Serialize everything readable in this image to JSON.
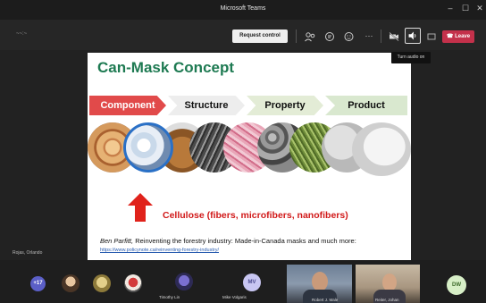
{
  "window": {
    "title": "Microsoft Teams",
    "minimize": "–",
    "maximize": "☐",
    "close": "✕"
  },
  "toolbar": {
    "timer": "~~:~",
    "request_control_label": "Request control",
    "more_label": "···",
    "leave_label": "Leave",
    "audio_tooltip": "Turn audio on"
  },
  "stage": {
    "presenter_name": "Rojas, Orlando"
  },
  "slide": {
    "title": "Can-Mask Concept",
    "steps": [
      "Component",
      "Structure",
      "Property",
      "Product"
    ],
    "cellulose_label": "Cellulose (fibers, microfibers, nanofibers)",
    "citation_author": "Ben Parfitt,",
    "citation_text": " Reinventing the forestry industry: Made-in-Canada masks and much more:",
    "citation_url": "https://www.policynote.ca/reinventing-forestry-industry/"
  },
  "participants": {
    "overflow_count": "+17",
    "tiles": [
      {
        "name": "Timothy Lin"
      },
      {
        "name": "Mike Volgaris",
        "initials": "MV"
      },
      {
        "name": "Robert J. Male"
      },
      {
        "name": "Reiter, Johan"
      }
    ],
    "dw_initials": "DW"
  },
  "colors": {
    "leave": "#c4314b",
    "accent_red": "#e14a4a",
    "title_green": "#1e7a52",
    "avatar_purple": "#5b5fc7"
  }
}
